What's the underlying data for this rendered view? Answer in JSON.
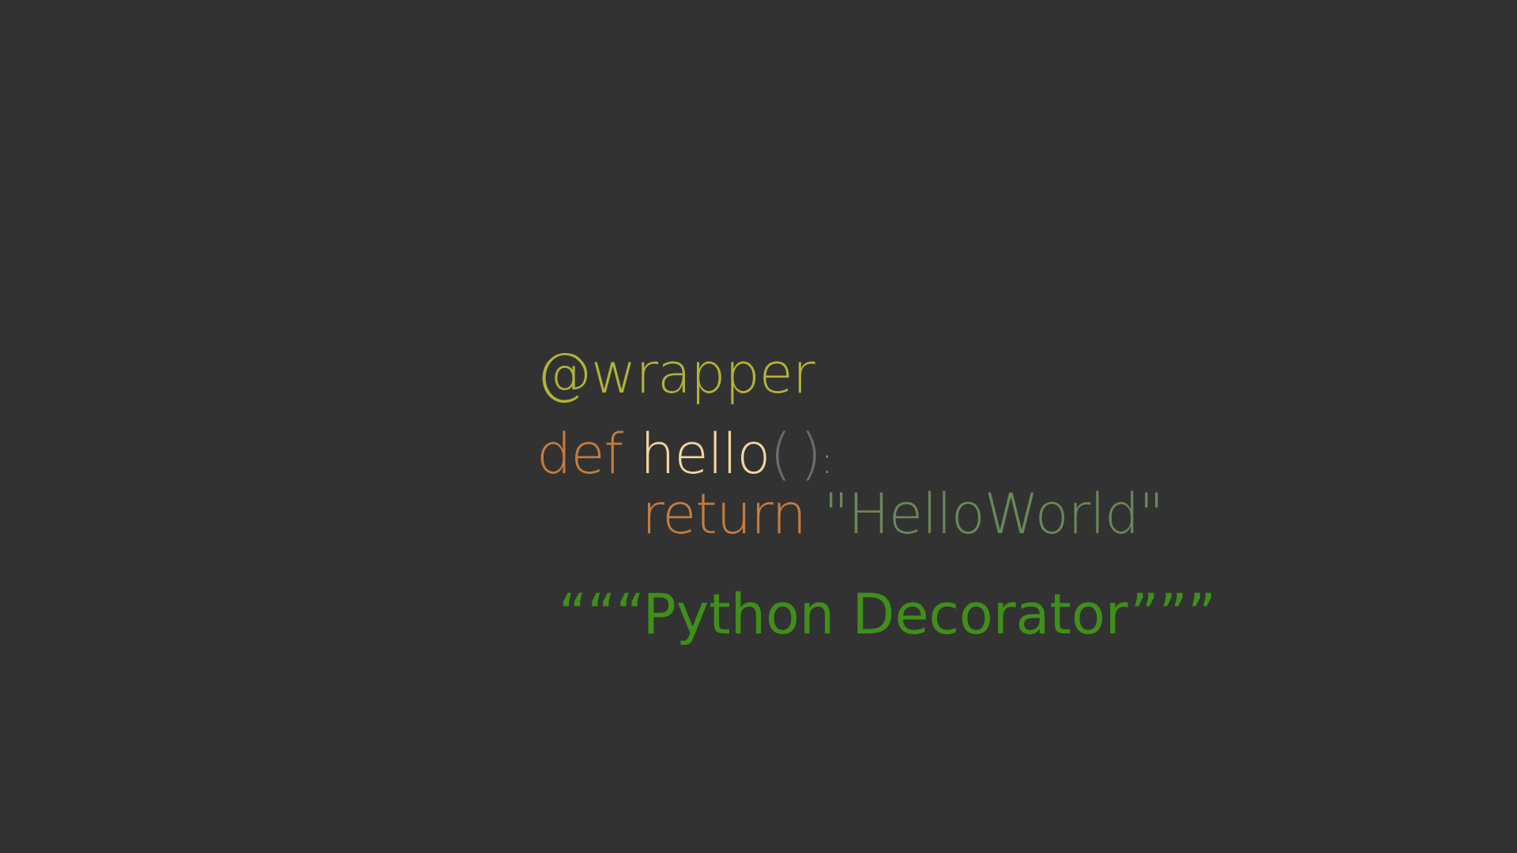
{
  "colors": {
    "background": "#323232",
    "decorator": "#b0b33a",
    "keyword": "#c67c3e",
    "function_name": "#f3d6a2",
    "paren": "#6c6c6c",
    "colon": "#8a8a8a",
    "string": "#6a8759",
    "docstring": "#3f8f1a"
  },
  "code": {
    "decorator": "@wrapper",
    "def_keyword": "def",
    "function_name": "hello",
    "open_paren": "(",
    "close_paren": ")",
    "colon": ":",
    "return_keyword": "return",
    "return_value": "\"HelloWorld\"",
    "docstring": "“““Python Decorator”””"
  }
}
